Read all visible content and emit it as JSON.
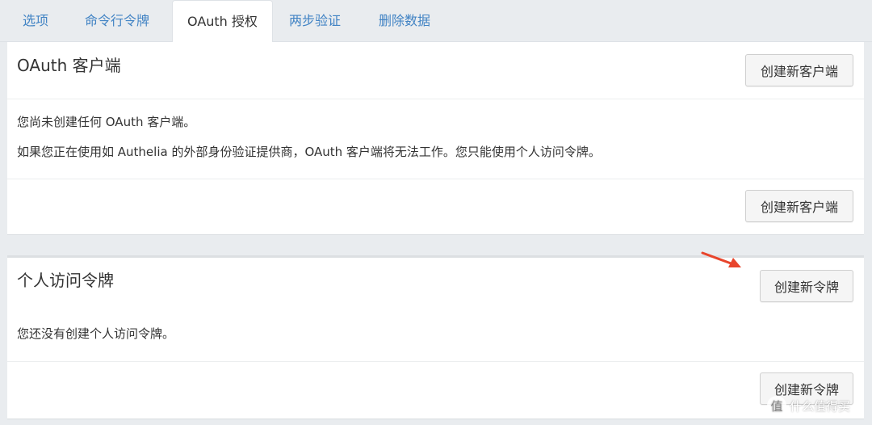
{
  "tabs": [
    {
      "label": "选项",
      "active": false
    },
    {
      "label": "命令行令牌",
      "active": false
    },
    {
      "label": "OAuth 授权",
      "active": true
    },
    {
      "label": "两步验证",
      "active": false
    },
    {
      "label": "删除数据",
      "active": false
    }
  ],
  "oauth_card": {
    "title": "OAuth 客户端",
    "create_button": "创建新客户端",
    "line1": "您尚未创建任何 OAuth 客户端。",
    "line2": "如果您正在使用如 Authelia 的外部身份验证提供商，OAuth 客户端将无法工作。您只能使用个人访问令牌。",
    "footer_button": "创建新客户端"
  },
  "token_card": {
    "title": "个人访问令牌",
    "create_button": "创建新令牌",
    "line1": "您还没有创建个人访问令牌。",
    "footer_button": "创建新令牌"
  },
  "watermark": {
    "icon_glyph": "值",
    "text": "什么值得买"
  },
  "colors": {
    "link": "#4183c4",
    "arrow": "#e8452c"
  }
}
